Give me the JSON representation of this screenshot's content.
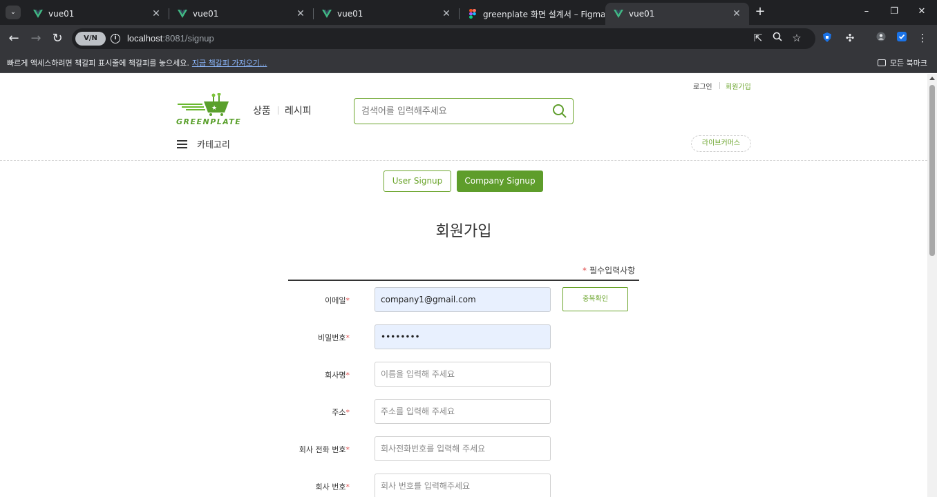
{
  "browser": {
    "tab_menu_icon": "chevron-down-icon",
    "tabs": [
      {
        "title": "vue01",
        "icon": "vue-icon"
      },
      {
        "title": "vue01",
        "icon": "vue-icon"
      },
      {
        "title": "vue01",
        "icon": "vue-icon"
      },
      {
        "title": "greenplate 화면 설계서 – Figma",
        "icon": "figma-icon"
      },
      {
        "title": "vue01",
        "icon": "vue-icon",
        "active": true
      }
    ],
    "new_tab": "+",
    "url_host": "localhost",
    "url_rest": ":8081/signup",
    "vpn_badge": "V/N",
    "bookmark_bar": {
      "message": "빠르게 액세스하려면 책갈피 표시줄에 책갈피를 놓으세요.",
      "link": "지금 책갈피 가져오기...",
      "all_bookmarks": "모든 북마크"
    }
  },
  "header": {
    "util_links": {
      "login": "로그인",
      "signup": "회원가입"
    },
    "logo_text": "GREENPLATE",
    "nav": {
      "products": "상품",
      "recipes": "레시피"
    },
    "search_placeholder": "검색어를 입력해주세요",
    "category_label": "카테고리",
    "live_commerce": "라이브커머스"
  },
  "signup": {
    "tabs": {
      "user": "User Signup",
      "company": "Company Signup",
      "active": "company"
    },
    "title": "회원가입",
    "required_note": "필수입력사항",
    "required_star": "*",
    "fields": {
      "email": {
        "label": "이메일",
        "value": "company1@gmail.com",
        "placeholder": ""
      },
      "password": {
        "label": "비밀번호",
        "value": "12345678",
        "placeholder": ""
      },
      "company_name": {
        "label": "회사명",
        "value": "",
        "placeholder": "이름을 입력해 주세요"
      },
      "address": {
        "label": "주소",
        "value": "",
        "placeholder": "주소를 입력해 주세요"
      },
      "company_phone": {
        "label": "회사 전화 번호",
        "value": "",
        "placeholder": "회사전화번호를 입력해 주세요"
      },
      "company_number": {
        "label": "회사 번호",
        "value": "",
        "placeholder": "회사 번호를 입력해주세요"
      }
    },
    "dup_check_button": "중복확인"
  },
  "colors": {
    "brand_green": "#6aa42a",
    "button_green": "#5e9d2b",
    "required_red": "#e05050",
    "autofill_bg": "#e8f0fe"
  }
}
